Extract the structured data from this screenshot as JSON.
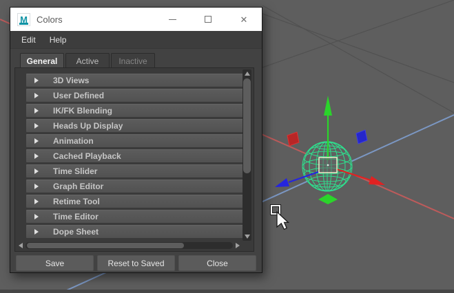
{
  "window": {
    "title": "Colors",
    "icon_letter": "M"
  },
  "menubar": {
    "items": [
      "Edit",
      "Help"
    ]
  },
  "tabs": [
    {
      "label": "General",
      "selected": true,
      "enabled": true
    },
    {
      "label": "Active",
      "selected": false,
      "enabled": true
    },
    {
      "label": "Inactive",
      "selected": false,
      "enabled": false
    }
  ],
  "sections": [
    "3D Views",
    "User Defined",
    "IK/FK Blending",
    "Heads Up Display",
    "Animation",
    "Cached Playback",
    "Time Slider",
    "Graph Editor",
    "Retime Tool",
    "Time Editor",
    "Dope Sheet"
  ],
  "footer_buttons": [
    "Save",
    "Reset to Saved",
    "Close"
  ],
  "colors": {
    "titlebar_bg": "#ffffff",
    "titlebar_text": "#5a5a5a",
    "dialog_bg": "#424242",
    "menubar_bg": "#3d3d3d",
    "panel_bg": "#3a3a3a",
    "row_bg": "#565656",
    "button_bg": "#5b5b5b",
    "maya_teal": "#0f93a5",
    "viewport_bg": "#5e5e5e",
    "grid_line": "#515151",
    "axis_x_line": "#bd5b5b",
    "axis_z_line": "#7b97c3",
    "manip_x": "#e02222",
    "manip_y": "#2bd42b",
    "manip_z": "#2525e0",
    "plane_handle_x": "#b82626",
    "plane_handle_z": "#2526cc",
    "sphere_wire": "#2ee08e",
    "center_box": "#eeedc9"
  },
  "viewport": {
    "tool": "select",
    "selected_object": "sphere"
  }
}
